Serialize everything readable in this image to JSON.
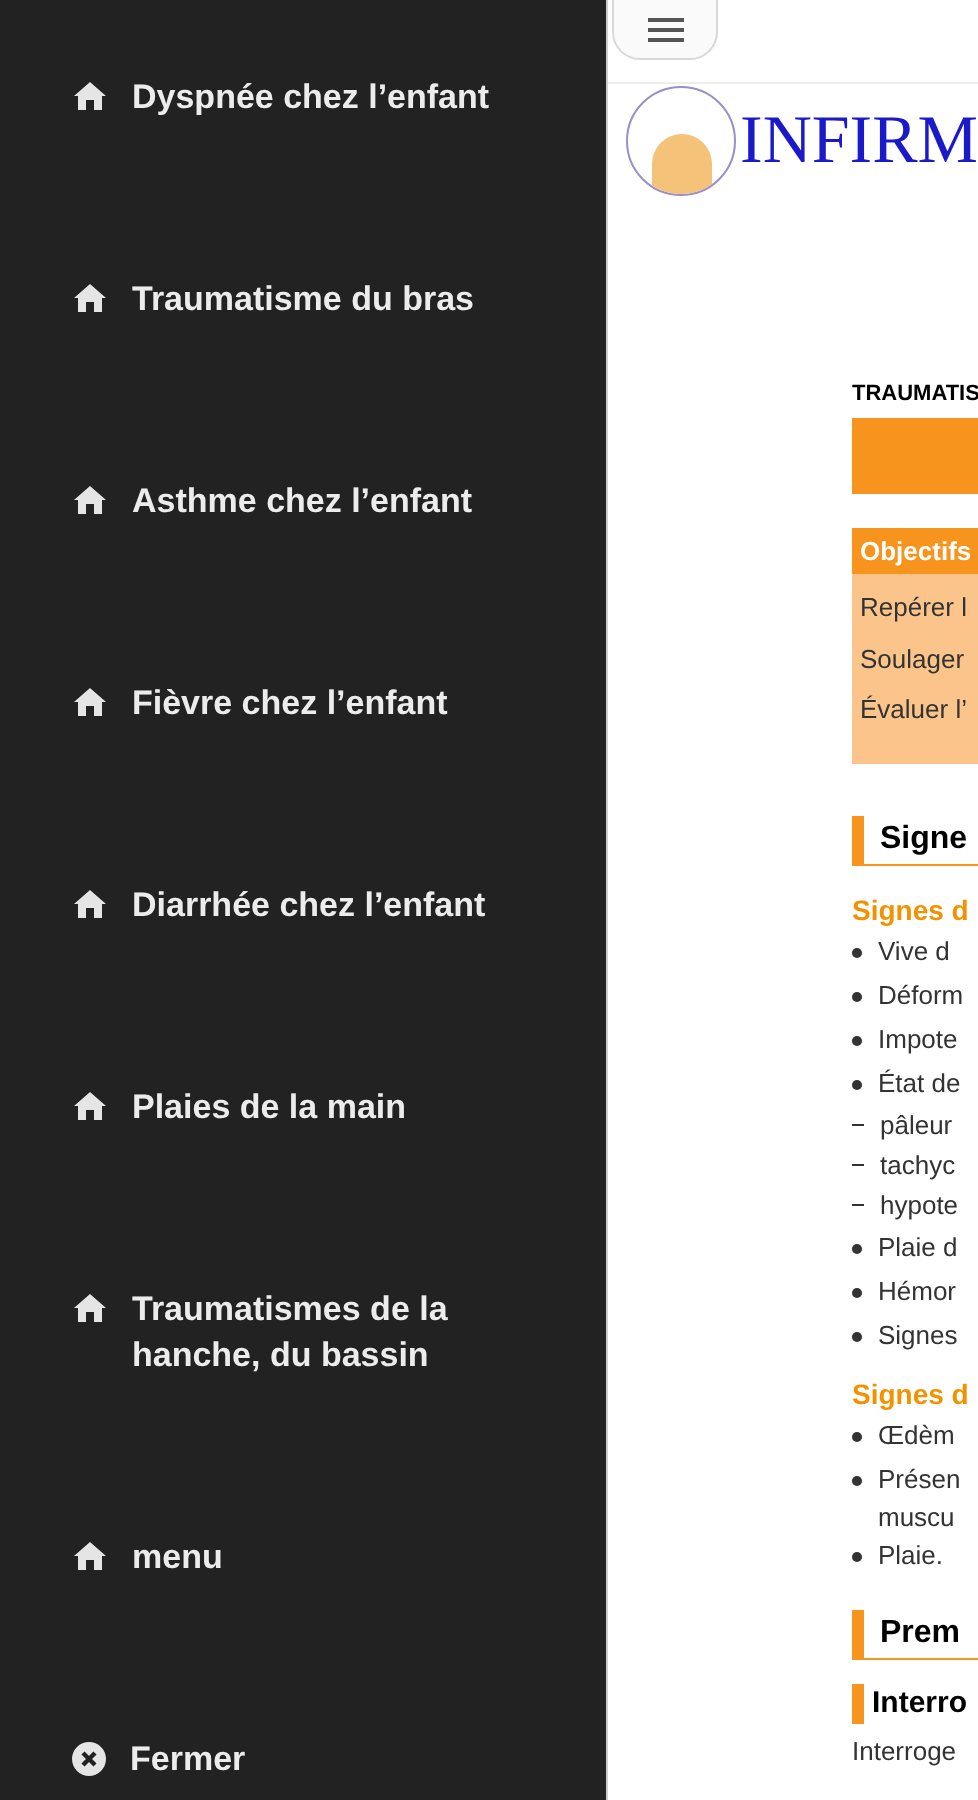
{
  "drawer": {
    "items": [
      {
        "kind": "home",
        "label": "Dyspnée chez l’enfant"
      },
      {
        "kind": "home",
        "label": "Traumatisme du bras"
      },
      {
        "kind": "home",
        "label": "Asthme chez l’enfant"
      },
      {
        "kind": "home",
        "label": "Fièvre chez l’enfant"
      },
      {
        "kind": "home",
        "label": "Diarrhée chez l’enfant"
      },
      {
        "kind": "home",
        "label": "Plaies de la main"
      },
      {
        "kind": "home",
        "label": "Traumatismes de la hanche, du bassin"
      },
      {
        "kind": "home",
        "label": "menu"
      },
      {
        "kind": "close",
        "label": "Fermer"
      }
    ]
  },
  "page": {
    "logo_text": "INFIRM",
    "doc_title": "TRAUMATIS",
    "objectives": {
      "title": "Objectifs",
      "lines": [
        "Repérer l",
        "Soulager",
        "Évaluer l’"
      ]
    },
    "blocks": [
      {
        "kind": "section",
        "text": "Signe"
      },
      {
        "kind": "subhead",
        "text": "Signes d"
      },
      {
        "kind": "bullet",
        "text": "Vive d"
      },
      {
        "kind": "bullet",
        "text": "Déform"
      },
      {
        "kind": "bullet",
        "text": "Impote"
      },
      {
        "kind": "bullet",
        "text": "État de"
      },
      {
        "kind": "dash",
        "text": "pâleur"
      },
      {
        "kind": "dash",
        "text": "tachyc"
      },
      {
        "kind": "dash",
        "text": "hypote"
      },
      {
        "kind": "bullet",
        "text": "Plaie d"
      },
      {
        "kind": "bullet",
        "text": "Hémor"
      },
      {
        "kind": "bullet",
        "text": "Signes"
      },
      {
        "kind": "subhead",
        "text": "Signes d"
      },
      {
        "kind": "bullet",
        "text": "Œdèm"
      },
      {
        "kind": "bullet",
        "text": "Présen",
        "cont": "muscu"
      },
      {
        "kind": "bullet",
        "text": "Plaie."
      },
      {
        "kind": "section",
        "text": "Prem"
      },
      {
        "kind": "minihead",
        "text": "Interro"
      },
      {
        "kind": "para",
        "text": "Interroge"
      }
    ]
  }
}
